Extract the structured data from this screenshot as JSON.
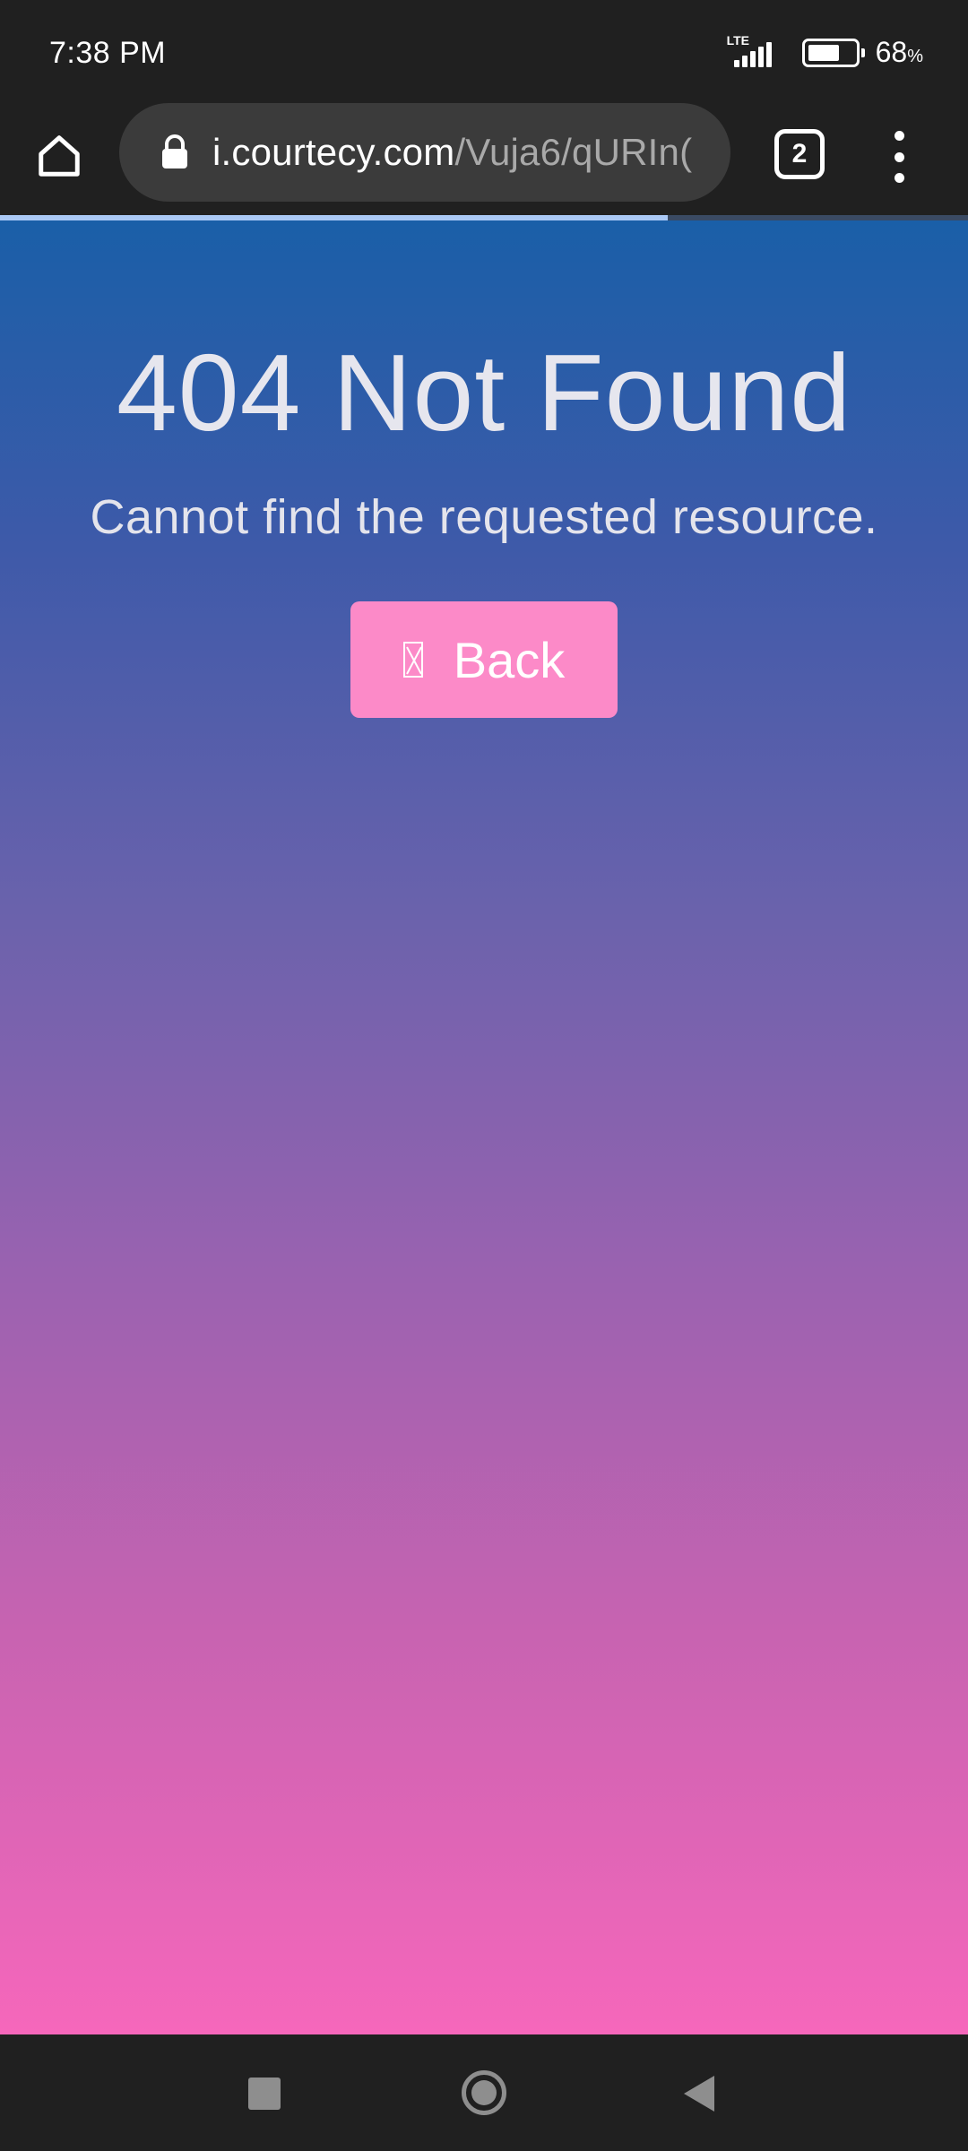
{
  "status_bar": {
    "time": "7:38 PM",
    "network": "LTE",
    "battery_level": 0.68,
    "battery_percent": "68",
    "battery_unit": "%"
  },
  "browser": {
    "url_domain": "i.courtecy.com",
    "url_path": "/Vuja6/qURIn(",
    "tab_count": "2",
    "load_progress": 0.69
  },
  "page": {
    "title": "404 Not Found",
    "subtitle": "Cannot find the requested resource.",
    "back_button_label": "Back",
    "back_button_icon": "missing-glyph-icon",
    "gradient_top": "#1a5fa8",
    "gradient_bottom": "#f667bb",
    "button_color": "#fc8ac8"
  },
  "icons": {
    "home": "home-icon",
    "lock": "lock-icon",
    "tabs": "tab-switcher-icon",
    "menu": "more-vert-icon",
    "nav_recents": "recents-square-icon",
    "nav_home": "home-circle-icon",
    "nav_back": "back-triangle-icon"
  }
}
